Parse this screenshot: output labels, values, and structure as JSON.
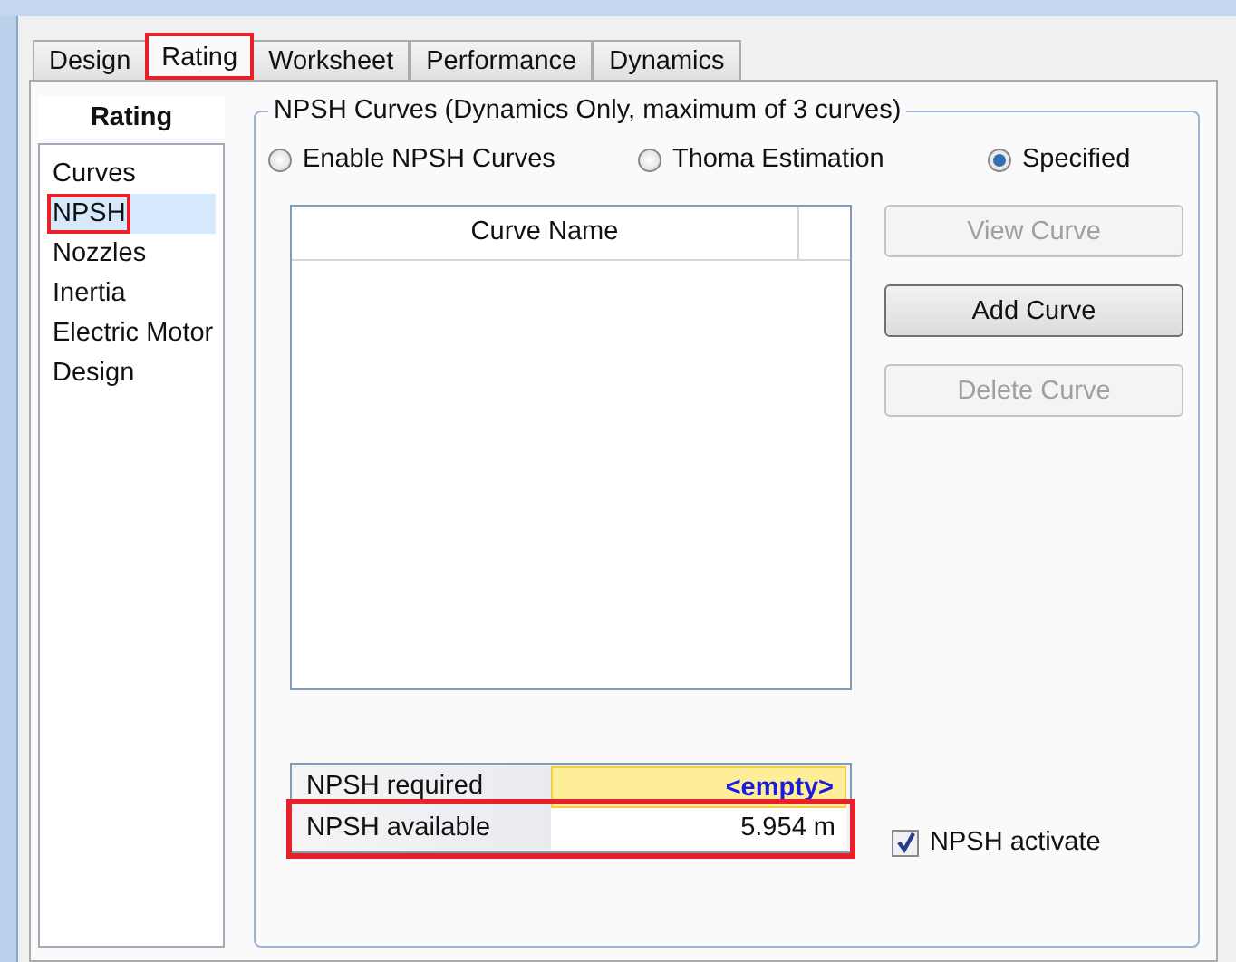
{
  "tabs": [
    {
      "label": "Design",
      "selected": false,
      "highlighted": false
    },
    {
      "label": "Rating",
      "selected": true,
      "highlighted": true
    },
    {
      "label": "Worksheet",
      "selected": false,
      "highlighted": false
    },
    {
      "label": "Performance",
      "selected": false,
      "highlighted": false
    },
    {
      "label": "Dynamics",
      "selected": false,
      "highlighted": false
    }
  ],
  "sidebar": {
    "title": "Rating",
    "items": [
      {
        "label": "Curves",
        "selected": false,
        "highlighted": false
      },
      {
        "label": "NPSH",
        "selected": true,
        "highlighted": true
      },
      {
        "label": "Nozzles",
        "selected": false,
        "highlighted": false
      },
      {
        "label": "Inertia",
        "selected": false,
        "highlighted": false
      },
      {
        "label": "Electric Motor",
        "selected": false,
        "highlighted": false
      },
      {
        "label": "Design",
        "selected": false,
        "highlighted": false
      }
    ]
  },
  "group": {
    "title": "NPSH Curves (Dynamics Only, maximum of 3 curves)",
    "radios": [
      {
        "label": "Enable NPSH Curves",
        "selected": false
      },
      {
        "label": "Thoma Estimation",
        "selected": false
      },
      {
        "label": "Specified",
        "selected": true
      }
    ],
    "table": {
      "columns": [
        "Curve Name"
      ]
    },
    "buttons": [
      {
        "label": "View Curve",
        "disabled": true
      },
      {
        "label": "Add Curve",
        "disabled": false
      },
      {
        "label": "Delete Curve",
        "disabled": true
      }
    ],
    "properties": [
      {
        "label": "NPSH required",
        "value": "<empty>",
        "kind": "empty",
        "highlighted": false
      },
      {
        "label": "NPSH available",
        "value": "5.954 m",
        "kind": "value",
        "highlighted": true
      }
    ],
    "checkbox": {
      "label": "NPSH activate",
      "checked": true
    }
  }
}
